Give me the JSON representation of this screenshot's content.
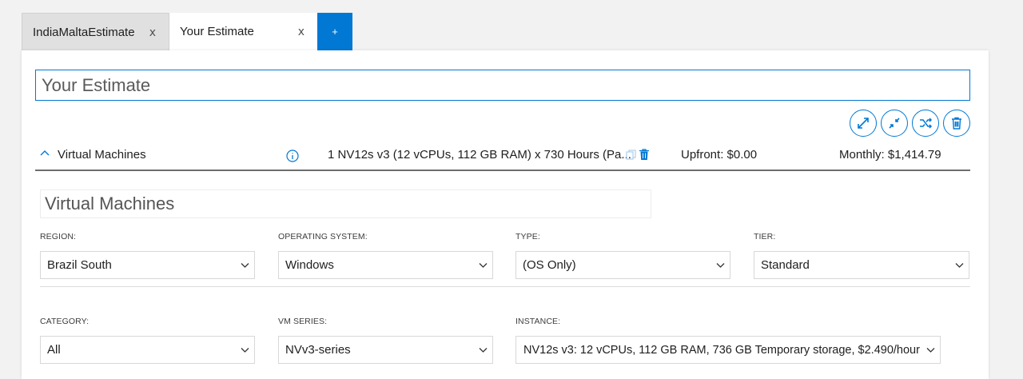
{
  "tabs": [
    {
      "label": "IndiaMaltaEstimate",
      "close": "x"
    },
    {
      "label": "Your Estimate",
      "close": "x"
    }
  ],
  "add_tab_label": "+",
  "estimate_title": "Your Estimate",
  "section": {
    "name": "Virtual Machines",
    "summary": "1 NV12s v3 (12 vCPUs, 112 GB RAM) x 730 Hours (Pa...",
    "upfront": "Upfront: $0.00",
    "monthly": "Monthly: $1,414.79"
  },
  "vm_title": "Virtual Machines",
  "fields_row1": [
    {
      "label": "REGION:",
      "value": "Brazil South"
    },
    {
      "label": "OPERATING SYSTEM:",
      "value": "Windows"
    },
    {
      "label": "TYPE:",
      "value": "(OS Only)"
    },
    {
      "label": "TIER:",
      "value": "Standard"
    }
  ],
  "fields_row2": [
    {
      "label": "CATEGORY:",
      "value": "All"
    },
    {
      "label": "VM SERIES:",
      "value": "NVv3-series"
    },
    {
      "label": "INSTANCE:",
      "value": "NV12s v3: 12 vCPUs, 112 GB RAM, 736 GB Temporary storage, $2.490/hour"
    }
  ],
  "colors": {
    "accent": "#0078d4"
  }
}
